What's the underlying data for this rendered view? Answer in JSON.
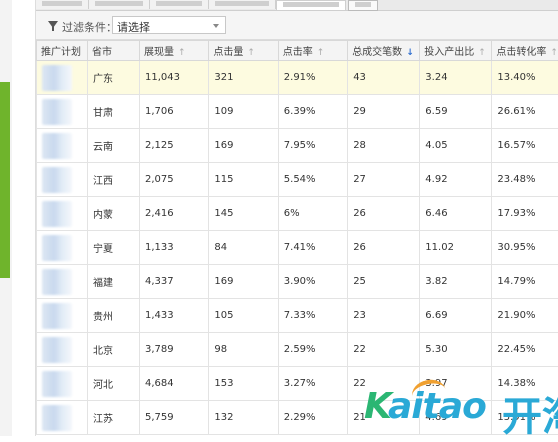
{
  "filter": {
    "label": "过滤条件：",
    "select_value": "请选择"
  },
  "table": {
    "headers": [
      "推广计划",
      "省市",
      "展现量",
      "点击量",
      "点击率",
      "总成交笔数",
      "投入产出比",
      "点击转化率"
    ],
    "sort_arrows": [
      "",
      "",
      "↑",
      "↑",
      "↑",
      "↓",
      "↑",
      "↑"
    ],
    "rows": [
      [
        "",
        "广东",
        "11,043",
        "321",
        "2.91%",
        "43",
        "3.24",
        "13.40%"
      ],
      [
        "",
        "甘肃",
        "1,706",
        "109",
        "6.39%",
        "29",
        "6.59",
        "26.61%"
      ],
      [
        "",
        "云南",
        "2,125",
        "169",
        "7.95%",
        "28",
        "4.05",
        "16.57%"
      ],
      [
        "",
        "江西",
        "2,075",
        "115",
        "5.54%",
        "27",
        "4.92",
        "23.48%"
      ],
      [
        "",
        "内蒙",
        "2,416",
        "145",
        "6%",
        "26",
        "6.46",
        "17.93%"
      ],
      [
        "",
        "宁夏",
        "1,133",
        "84",
        "7.41%",
        "26",
        "11.02",
        "30.95%"
      ],
      [
        "",
        "福建",
        "4,337",
        "169",
        "3.90%",
        "25",
        "3.82",
        "14.79%"
      ],
      [
        "",
        "贵州",
        "1,433",
        "105",
        "7.33%",
        "23",
        "6.69",
        "21.90%"
      ],
      [
        "",
        "北京",
        "3,789",
        "98",
        "2.59%",
        "22",
        "5.30",
        "22.45%"
      ],
      [
        "",
        "河北",
        "4,684",
        "153",
        "3.27%",
        "22",
        "3.97",
        "14.38%"
      ],
      [
        "",
        "江苏",
        "5,759",
        "132",
        "2.29%",
        "21",
        "4.69",
        "15.91%"
      ]
    ]
  },
  "watermark": {
    "k": "K",
    "rest": "aitao",
    "cn": "开淘"
  },
  "colors": {
    "accent_green": "#6fb42c",
    "sort_active": "#2f6fd0",
    "row_highlight": "#fdfbe0"
  }
}
